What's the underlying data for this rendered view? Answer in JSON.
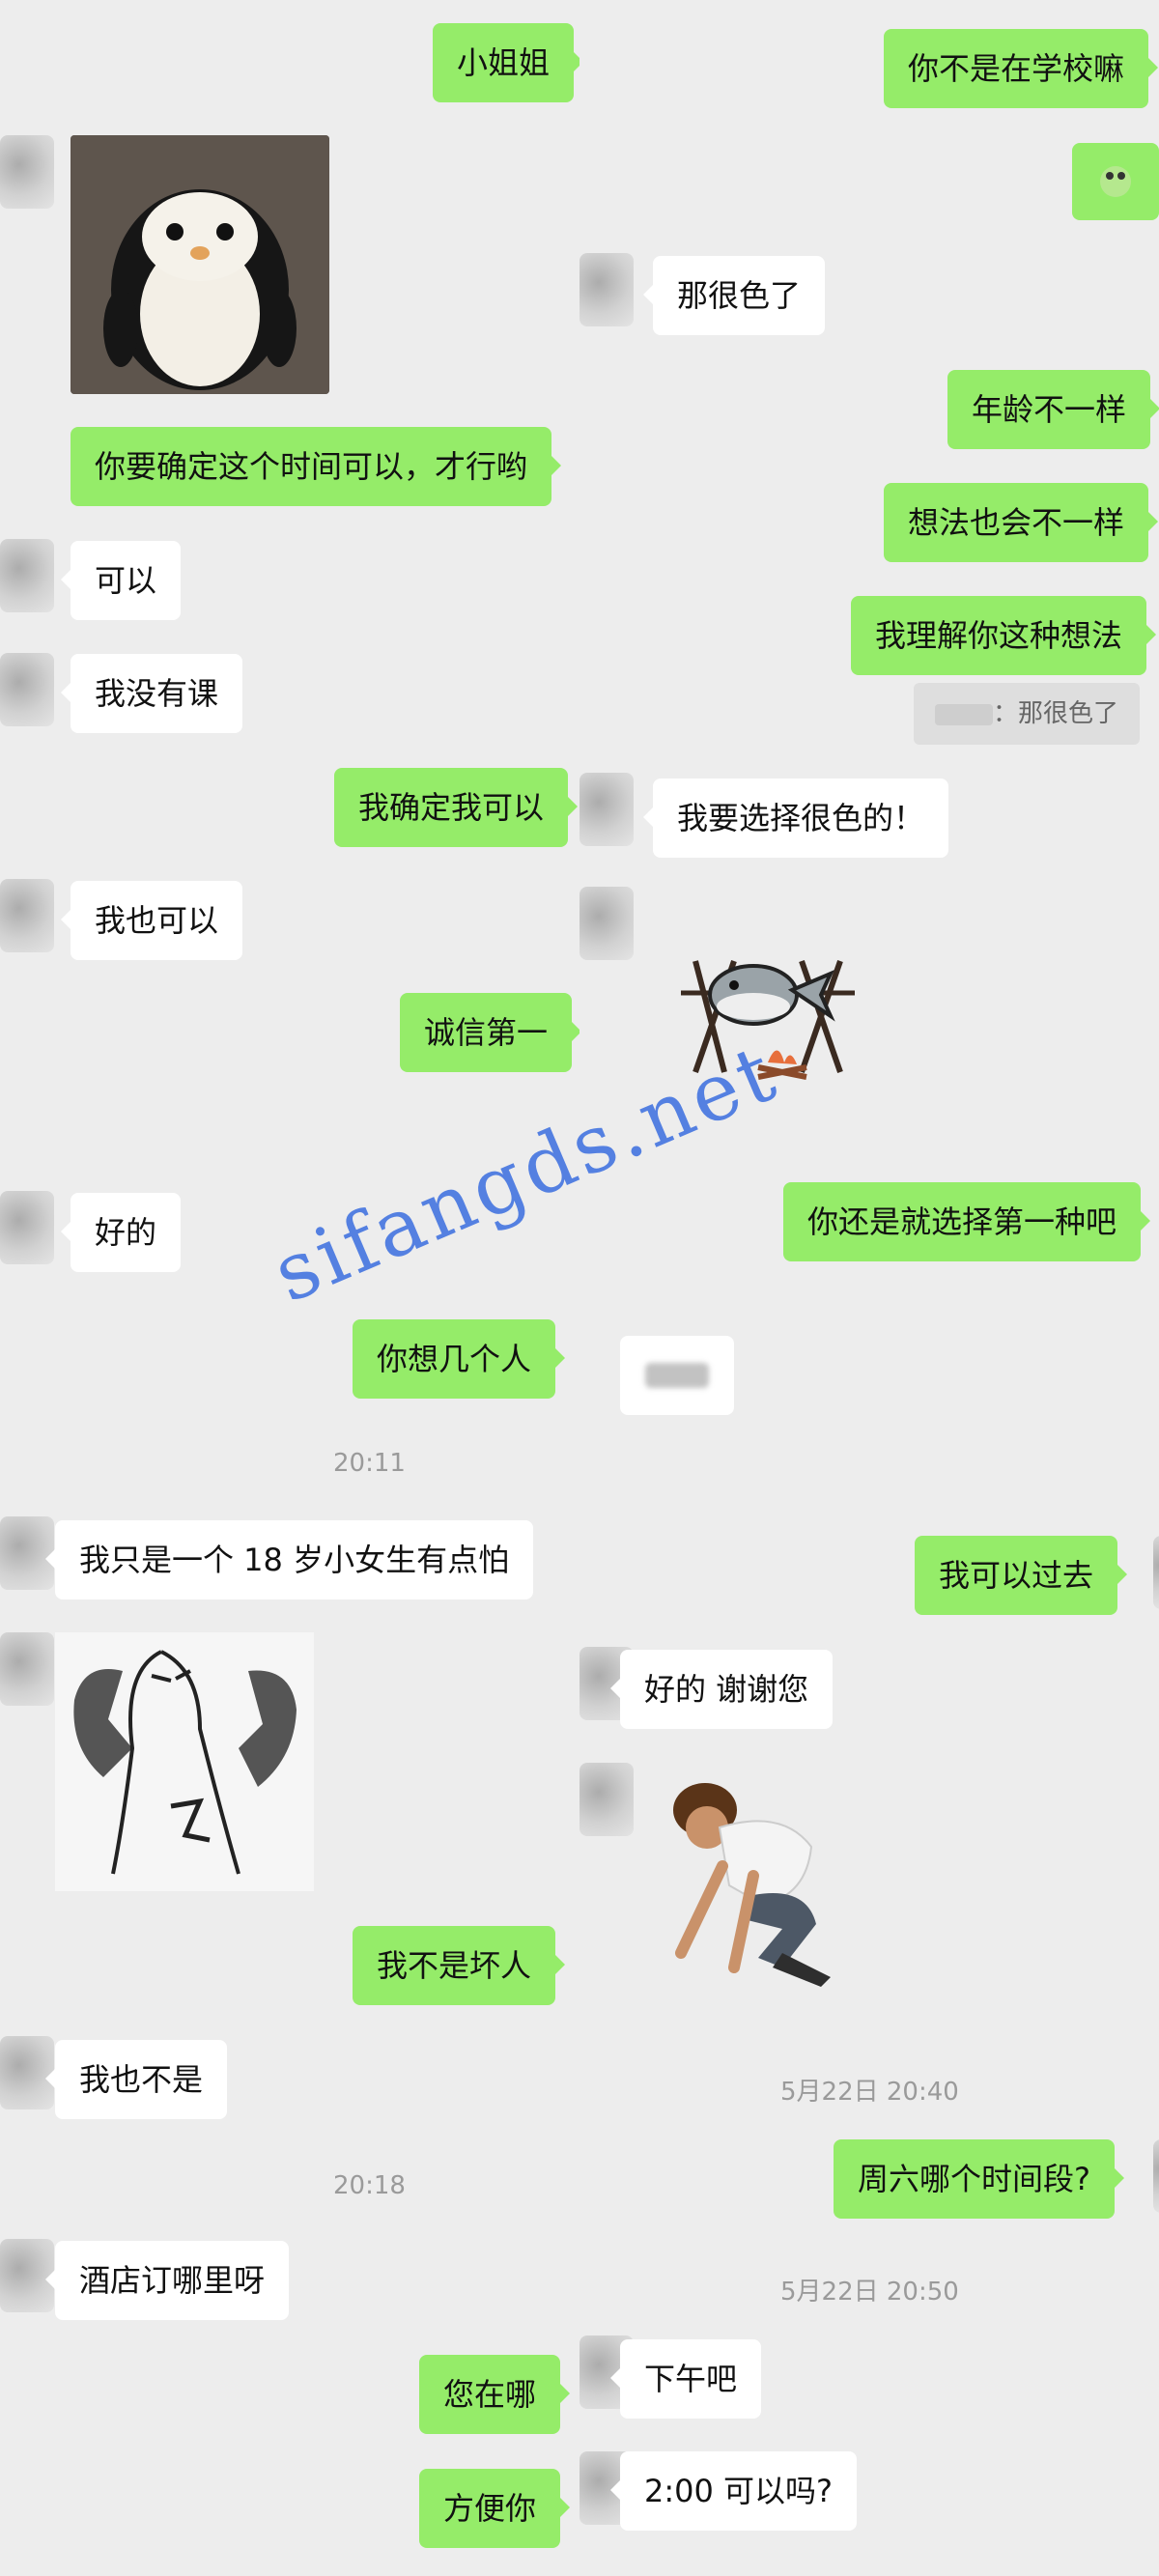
{
  "left": {
    "messages": [
      {
        "text": "小姐姐"
      },
      {
        "text": "你要确定这个时间可以，才行哟"
      },
      {
        "text": "可以"
      },
      {
        "text": "我没有课"
      },
      {
        "text": "我确定我可以"
      },
      {
        "text": "我也可以"
      },
      {
        "text": "诚信第一"
      },
      {
        "text": "好的"
      },
      {
        "text": "你想几个人"
      },
      {
        "text": "我只是一个 18 岁小女生有点怕"
      },
      {
        "text": "我不是坏人"
      },
      {
        "text": "我也不是"
      },
      {
        "text": "酒店订哪里呀"
      },
      {
        "text": "您在哪"
      },
      {
        "text": "方便你"
      }
    ],
    "timestamps": [
      "20:11",
      "20:18"
    ],
    "stickers": [
      {
        "name": "penguin-sticker"
      },
      {
        "name": "broken-heart-sticker"
      }
    ]
  },
  "right": {
    "messages": [
      {
        "text": "你不是在学校嘛"
      },
      {
        "text": "那很色了"
      },
      {
        "text": "年龄不一样"
      },
      {
        "text": "想法也会不一样"
      },
      {
        "text": "我理解你这种想法"
      },
      {
        "text": "我要选择很色的！"
      },
      {
        "text": "你还是就选择第一种吧"
      },
      {
        "text": "我可以过去"
      },
      {
        "text": "好的 谢谢您"
      },
      {
        "text": "周六哪个时间段?"
      },
      {
        "text": "下午吧"
      },
      {
        "text": "2:00 可以吗?"
      }
    ],
    "quote": "：那很色了",
    "timestamps": [
      "5月22日 20:40",
      "5月22日 20:50"
    ],
    "stickers": [
      {
        "name": "roasted-fish-sticker"
      },
      {
        "name": "kneeling-man-sticker"
      }
    ]
  },
  "watermark": "sifangds.net",
  "colors": {
    "sent": "#95ec69",
    "received": "#ffffff",
    "background": "#ededed",
    "watermark": "#3a6de0"
  }
}
